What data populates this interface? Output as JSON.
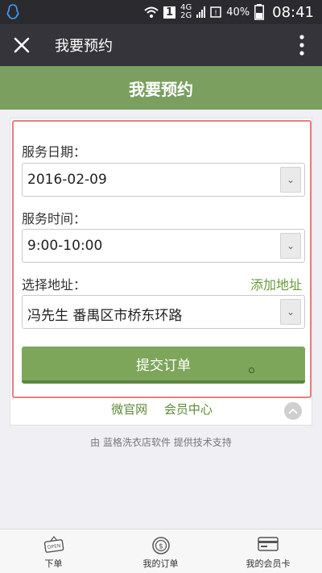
{
  "status_bar": {
    "sim": "1",
    "net_top": "4G",
    "net_bottom": "2G",
    "battery": "40%",
    "time": "08:41",
    "icons": [
      "qq-icon",
      "wifi-icon",
      "signal-icon",
      "battery-icon"
    ]
  },
  "app_bar": {
    "title": "我要预约",
    "close_icon": "close-icon",
    "more_icon": "more-vertical-icon"
  },
  "header": {
    "title": "我要预约"
  },
  "form": {
    "date_label": "服务日期：",
    "date_value": "2016-02-09",
    "time_label": "服务时间：",
    "time_value": "9:00-10:00",
    "address_label": "选择地址：",
    "add_address": "添加地址",
    "address_value": "冯先生 番禺区市桥东环路",
    "submit": "提交订单",
    "highlight_color": "#e87f7f"
  },
  "links": {
    "official": "微官网",
    "member_center": "会员中心"
  },
  "powered_by": "由 蓝格洗衣店软件 提供技术支持",
  "tabs": [
    {
      "label": "下单",
      "icon": "open-sign-icon"
    },
    {
      "label": "我的订单",
      "icon": "dollar-coin-icon"
    },
    {
      "label": "我的会员卡",
      "icon": "card-icon"
    }
  ],
  "colors": {
    "brand_green": "#7a9f5f",
    "button_green": "#7da65b",
    "link_green": "#6a9a3a",
    "dark_bar": "#34343a"
  }
}
